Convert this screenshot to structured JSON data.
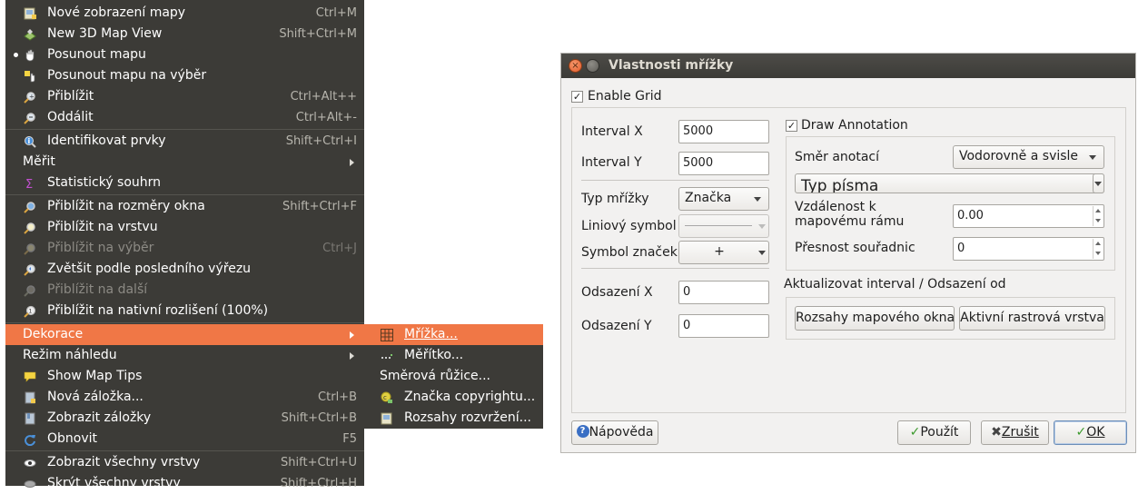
{
  "menu": {
    "items": [
      {
        "label": "Nové zobrazení mapy",
        "shortcut": "Ctrl+M",
        "icon": "new-map-view-icon"
      },
      {
        "label": "New 3D Map View",
        "shortcut": "Shift+Ctrl+M",
        "icon": "new-3d-map-view-icon"
      },
      {
        "label": "Posunout mapu",
        "shortcut": "",
        "icon": "pan-hand-icon",
        "checked": true
      },
      {
        "label": "Posunout mapu na výběr",
        "shortcut": "",
        "icon": "pan-to-selection-icon"
      },
      {
        "label": "Přiblížit",
        "shortcut": "Ctrl+Alt++",
        "icon": "zoom-in-icon"
      },
      {
        "label": "Oddálit",
        "shortcut": "Ctrl+Alt+-",
        "icon": "zoom-out-icon"
      },
      {
        "label": "Identifikovat prvky",
        "shortcut": "Shift+Ctrl+I",
        "icon": "identify-icon"
      },
      {
        "label": "Měřit",
        "shortcut": "",
        "submenu": true
      },
      {
        "label": "Statistický souhrn",
        "shortcut": "",
        "icon": "statistics-icon"
      },
      {
        "label": "Přiblížit na rozměry okna",
        "shortcut": "Shift+Ctrl+F",
        "icon": "zoom-full-icon"
      },
      {
        "label": "Přiblížit na vrstvu",
        "shortcut": "",
        "icon": "zoom-to-layer-icon"
      },
      {
        "label": "Přiblížit na výběr",
        "shortcut": "Ctrl+J",
        "icon": "zoom-to-selection-icon",
        "disabled": true
      },
      {
        "label": "Zvětšit podle posledního výřezu",
        "shortcut": "",
        "icon": "zoom-last-icon"
      },
      {
        "label": "Přiblížit na další",
        "shortcut": "",
        "icon": "zoom-next-icon",
        "disabled": true
      },
      {
        "label": "Přiblížit na nativní rozlišení (100%)",
        "shortcut": "",
        "icon": "zoom-actual-icon"
      },
      {
        "label": "Dekorace",
        "shortcut": "",
        "submenu": true,
        "highlighted": true
      },
      {
        "label": "Režim náhledu",
        "shortcut": "",
        "submenu": true
      },
      {
        "label": "Show Map Tips",
        "shortcut": "",
        "icon": "map-tips-icon"
      },
      {
        "label": "Nová záložka...",
        "shortcut": "Ctrl+B",
        "icon": "new-bookmark-icon"
      },
      {
        "label": "Zobrazit záložky",
        "shortcut": "Shift+Ctrl+B",
        "icon": "show-bookmarks-icon"
      },
      {
        "label": "Obnovit",
        "shortcut": "F5",
        "icon": "refresh-icon"
      },
      {
        "label": "Zobrazit všechny vrstvy",
        "shortcut": "Shift+Ctrl+U",
        "icon": "show-all-layers-icon"
      },
      {
        "label": "Skrýt všechny vrstvy",
        "shortcut": "Shift+Ctrl+H",
        "icon": "hide-all-layers-icon"
      }
    ],
    "decorations_submenu": [
      {
        "label": "Mřížka...",
        "icon": "grid-icon",
        "highlighted": true
      },
      {
        "label": "Měřítko...",
        "icon": "scale-bar-icon"
      },
      {
        "label": "Směrová růžice...",
        "icon": ""
      },
      {
        "label": "Značka copyrightu...",
        "icon": "copyright-icon"
      },
      {
        "label": "Rozsahy rozvržení...",
        "icon": "layout-extents-icon"
      }
    ]
  },
  "dialog": {
    "title": "Vlastnosti mřížky",
    "enable_grid_label": "Enable Grid",
    "enable_grid_checked": true,
    "interval_x_label": "Interval X",
    "interval_x_value": "5000",
    "interval_y_label": "Interval Y",
    "interval_y_value": "5000",
    "grid_type_label": "Typ mřížky",
    "grid_type_value": "Značka",
    "line_symbol_label": "Liniový symbol",
    "marker_symbol_label": "Symbol značek",
    "marker_symbol_glyph": "+",
    "offset_x_label": "Odsazení X",
    "offset_x_value": "0",
    "offset_y_label": "Odsazení Y",
    "offset_y_value": "0",
    "draw_annotation_label": "Draw Annotation",
    "draw_annotation_checked": true,
    "annotation_direction_label": "Směr anotací",
    "annotation_direction_value": "Vodorovně a svisle",
    "font_button_label": "Typ písma",
    "distance_label": "Vzdálenost k mapovému rámu",
    "distance_value": "0.00",
    "precision_label": "Přesnost souřadnic",
    "precision_value": "0",
    "update_from_label": "Aktualizovat interval / Odsazení od",
    "canvas_extents_button": "Rozsahy mapového okna",
    "active_raster_button": "Aktivní rastrová vrstva",
    "help_button": "Nápověda",
    "apply_button": "Použít",
    "cancel_button": "Zrušit",
    "ok_button": "OK"
  }
}
